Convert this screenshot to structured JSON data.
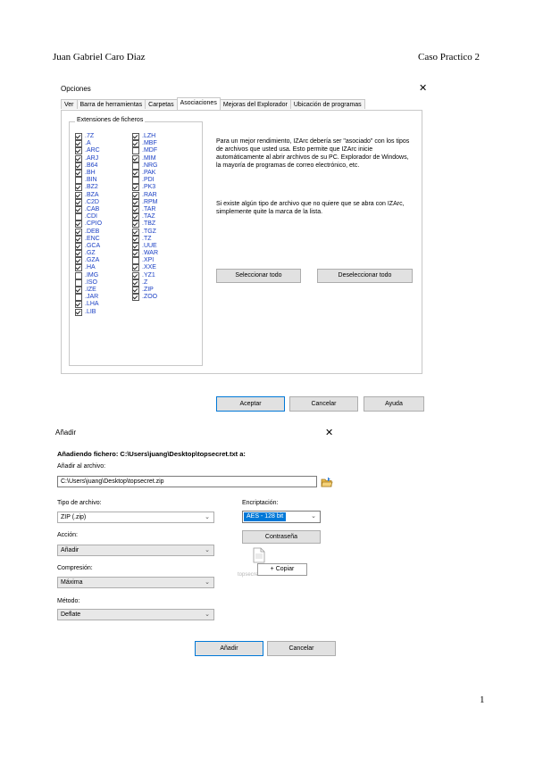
{
  "document": {
    "author": "Juan Gabriel Caro Diaz",
    "doc_title": "Caso Practico 2",
    "page_number": "1"
  },
  "options_dialog": {
    "title": "Opciones",
    "close_glyph": "✕",
    "tabs": [
      "Ver",
      "Barra de herramientas",
      "Carpetas",
      "Asociaciones",
      "Mejoras del Explorador",
      "Ubicación de programas"
    ],
    "active_tab": "Asociaciones",
    "group_label": "Extensiones de ficheros",
    "extensions_col1": [
      {
        "ext": ".7Z",
        "checked": true
      },
      {
        "ext": ".A",
        "checked": true
      },
      {
        "ext": ".ARC",
        "checked": true
      },
      {
        "ext": ".ARJ",
        "checked": true
      },
      {
        "ext": ".B64",
        "checked": true
      },
      {
        "ext": ".BH",
        "checked": true
      },
      {
        "ext": ".BIN",
        "checked": false
      },
      {
        "ext": ".BZ2",
        "checked": true
      },
      {
        "ext": ".BZA",
        "checked": true
      },
      {
        "ext": ".C2D",
        "checked": true
      },
      {
        "ext": ".CAB",
        "checked": true
      },
      {
        "ext": ".CDI",
        "checked": false
      },
      {
        "ext": ".CPIO",
        "checked": true
      },
      {
        "ext": ".DEB",
        "checked": true
      },
      {
        "ext": ".ENC",
        "checked": true
      },
      {
        "ext": ".GCA",
        "checked": true
      },
      {
        "ext": ".GZ",
        "checked": true
      },
      {
        "ext": ".GZA",
        "checked": true
      },
      {
        "ext": ".HA",
        "checked": true
      },
      {
        "ext": ".IMG",
        "checked": false
      },
      {
        "ext": ".ISO",
        "checked": false
      },
      {
        "ext": ".IZE",
        "checked": true
      },
      {
        "ext": ".JAR",
        "checked": false
      },
      {
        "ext": ".LHA",
        "checked": true
      },
      {
        "ext": ".LIB",
        "checked": true
      }
    ],
    "extensions_col2": [
      {
        "ext": ".LZH",
        "checked": true
      },
      {
        "ext": ".MBF",
        "checked": true
      },
      {
        "ext": ".MDF",
        "checked": false
      },
      {
        "ext": ".MIM",
        "checked": true
      },
      {
        "ext": ".NRG",
        "checked": false
      },
      {
        "ext": ".PAK",
        "checked": true
      },
      {
        "ext": ".PDI",
        "checked": false
      },
      {
        "ext": ".PK3",
        "checked": true
      },
      {
        "ext": ".RAR",
        "checked": true
      },
      {
        "ext": ".RPM",
        "checked": true
      },
      {
        "ext": ".TAR",
        "checked": true
      },
      {
        "ext": ".TAZ",
        "checked": true
      },
      {
        "ext": ".TBZ",
        "checked": true
      },
      {
        "ext": ".TGZ",
        "checked": true
      },
      {
        "ext": ".TZ",
        "checked": true
      },
      {
        "ext": ".UUE",
        "checked": true
      },
      {
        "ext": ".WAR",
        "checked": true
      },
      {
        "ext": ".XPI",
        "checked": false
      },
      {
        "ext": ".XXE",
        "checked": true
      },
      {
        "ext": ".YZ1",
        "checked": true
      },
      {
        "ext": ".Z",
        "checked": true
      },
      {
        "ext": ".ZIP",
        "checked": true
      },
      {
        "ext": ".ZOO",
        "checked": true
      }
    ],
    "info_text_1": "Para un mejor rendimiento, IZArc debería ser \"asociado\" con los tipos de archivos que usted usa. Esto permite que IZArc inicie automáticamente al abrir archivos de su PC. Explorador de Windows, la mayoría de programas de correo electrónico, etc.",
    "info_text_2": "Si existe algún tipo de archivo que no quiere que se abra con IZArc, simplemente quite la marca de la lista.",
    "select_all_label": "Seleccionar todo",
    "deselect_all_label": "Deseleccionar todo",
    "accept_label": "Aceptar",
    "cancel_label": "Cancelar",
    "help_label": "Ayuda"
  },
  "add_dialog": {
    "title": "Añadir",
    "close_glyph": "✕",
    "heading": "Añadiendo fichero: C:\\Users\\juang\\Desktop\\topsecret.txt a:",
    "add_to_label": "Añadir al archivo:",
    "archive_path": "C:\\Users\\juang\\Desktop\\topsecret.zip",
    "file_type_label": "Tipo de archivo:",
    "file_type_value": "ZIP (.zip)",
    "encryption_label": "Encriptación:",
    "encryption_value": "AES - 128 bit",
    "action_label": "Acción:",
    "action_value": "Añadir",
    "password_label": "Contraseña",
    "compression_label": "Compresión:",
    "compression_value": "Máxima",
    "method_label": "Método:",
    "method_value": "Deflate",
    "drag_file_name": "topsecret.txt",
    "copy_tooltip": "+ Copiar",
    "add_label": "Añadir",
    "cancel_label": "Cancelar"
  }
}
